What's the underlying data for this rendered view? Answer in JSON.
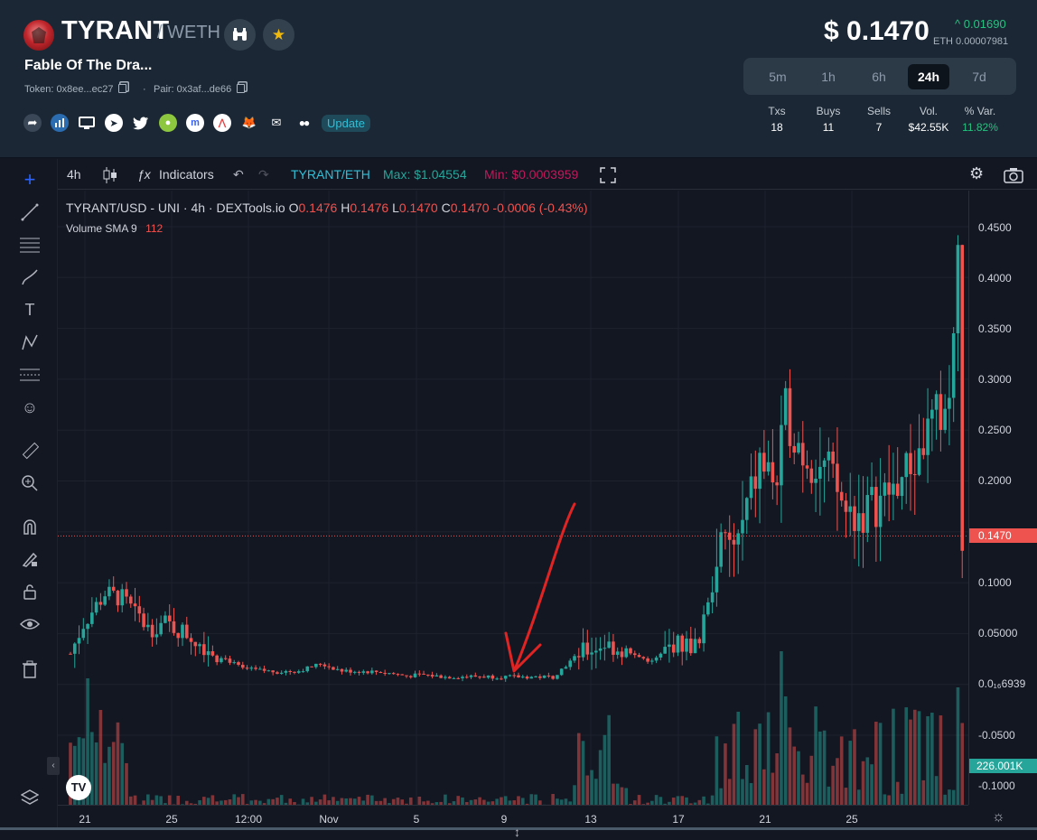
{
  "header": {
    "pair": "TYRANT",
    "quote": "/ WETH",
    "project": "Fable Of The Dra...",
    "token": "Token: 0x8ee...ec27",
    "pair_addr": "Pair: 0x3af...de66",
    "separator": "·",
    "update": "Update",
    "price": "$ 0.1470",
    "change": "^ 0.01690",
    "eth_price": "ETH 0.00007981",
    "timeframes": [
      "5m",
      "1h",
      "6h",
      "24h",
      "7d"
    ],
    "active_tf": "24h",
    "stats": {
      "headers": [
        "Txs",
        "Buys",
        "Sells",
        "Vol.",
        "% Var."
      ],
      "values": [
        "18",
        "11",
        "7",
        "$42.55K",
        "11.82%"
      ]
    }
  },
  "toolbar": {
    "interval": "4h",
    "indicators": "Indicators",
    "symbol": "TYRANT/ETH",
    "max": "Max: $1.04554",
    "min": "Min: $0.0003959"
  },
  "legend": {
    "title": "TYRANT/USD - UNI · 4h · DEXTools.io",
    "o_label": "O",
    "o": "0.1476",
    "h_label": "H",
    "h": "0.1476",
    "l_label": "L",
    "l": "0.1470",
    "c_label": "C",
    "c": "0.1470",
    "chg": "-0.0006 (-0.43%)",
    "volume": "Volume SMA 9",
    "volume_val": "112"
  },
  "price_scale": [
    "0.4500",
    "0.4000",
    "0.3500",
    "0.3000",
    "0.2500",
    "0.2000",
    "0.1000",
    "0.05000",
    "0.0₁₆6939",
    "-0.0500",
    "-0.1000"
  ],
  "current_price_label": "0.1470",
  "volume_label": "226.001K",
  "time_scale": [
    "21",
    "25",
    "12:00",
    "Nov",
    "5",
    "9",
    "13",
    "17",
    "21",
    "25"
  ],
  "colors": {
    "up": "#26a69a",
    "down": "#ef5350",
    "accent": "#2fc0d8"
  },
  "chart_data": {
    "type": "candlestick",
    "x": [
      "21",
      "25",
      "12:00",
      "Nov",
      "5",
      "9",
      "13",
      "17",
      "21",
      "25"
    ],
    "ylim": [
      -0.12,
      0.49
    ],
    "close_path": [
      [
        0,
        0.03
      ],
      [
        3,
        0.06
      ],
      [
        8,
        0.09
      ],
      [
        12,
        0.085
      ],
      [
        18,
        0.055
      ],
      [
        22,
        0.06
      ],
      [
        27,
        0.05
      ],
      [
        34,
        0.03
      ],
      [
        40,
        0.015
      ],
      [
        48,
        0.012
      ],
      [
        53,
        0.013
      ],
      [
        58,
        0.02
      ],
      [
        63,
        0.013
      ],
      [
        72,
        0.012
      ],
      [
        78,
        0.008
      ],
      [
        82,
        0.009
      ],
      [
        87,
        0.007
      ],
      [
        95,
        0.0075
      ],
      [
        102,
        0.007
      ],
      [
        112,
        0.007
      ],
      [
        118,
        0.03
      ],
      [
        124,
        0.04
      ],
      [
        130,
        0.03
      ],
      [
        135,
        0.022
      ],
      [
        140,
        0.04
      ],
      [
        146,
        0.038
      ],
      [
        150,
        0.13
      ],
      [
        155,
        0.14
      ],
      [
        160,
        0.22
      ],
      [
        164,
        0.2
      ],
      [
        166,
        0.27
      ],
      [
        170,
        0.23
      ],
      [
        176,
        0.21
      ],
      [
        180,
        0.17
      ],
      [
        184,
        0.17
      ],
      [
        190,
        0.19
      ],
      [
        196,
        0.22
      ],
      [
        200,
        0.26
      ],
      [
        204,
        0.28
      ],
      [
        206,
        0.42
      ],
      [
        207,
        0.147
      ]
    ],
    "volume_max": 226001
  }
}
